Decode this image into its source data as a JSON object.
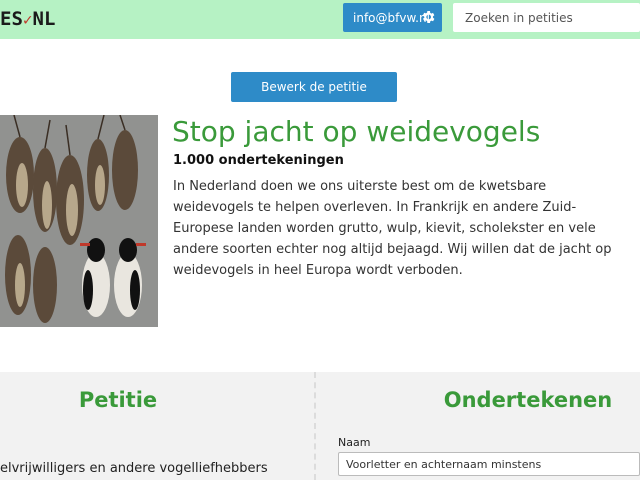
{
  "header": {
    "logo_text": "ES",
    "logo_check": "✓",
    "logo_suffix": "NL",
    "account_email": "info@bfvw.nl",
    "account_icon": "gear-icon",
    "search_placeholder": "Zoeken in petities",
    "background_color": "#b6f2c4",
    "button_color": "#2e8bc8"
  },
  "actions": {
    "edit_label": "Bewerk de petitie"
  },
  "petition": {
    "image_subject": "dode weidevogels",
    "title": "Stop jacht op weidevogels",
    "signatures": "1.000 ondertekeningen",
    "description": "In Nederland doen we ons uiterste best om de kwetsbare weidevogels te helpen overleven. In Frankrijk en andere Zuid-Europese landen worden grutto, wulp, kievit, scholekster en vele andere soorten echter nog altijd bejaagd. Wij willen dat de jacht op weidevogels in heel Europa wordt verboden.",
    "title_color": "#3a9a3a"
  },
  "petitie_section": {
    "heading": "Petitie",
    "text": "elvrijwilligers en andere vogelliefhebbers"
  },
  "sign_section": {
    "heading": "Ondertekenen",
    "name_label": "Naam",
    "name_placeholder": "Voorletter en achternaam minstens"
  }
}
